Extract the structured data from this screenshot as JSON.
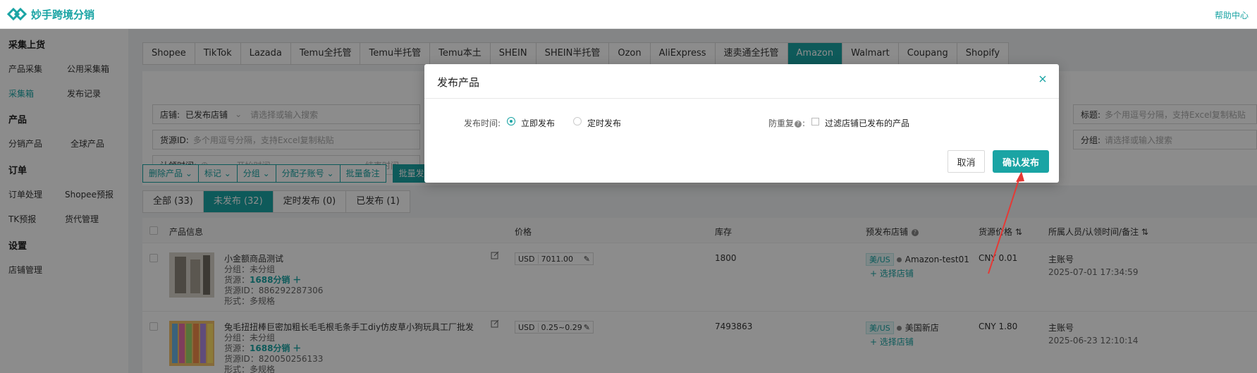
{
  "header": {
    "app_name": "妙手跨境分销",
    "help": "帮助中心"
  },
  "sidebar": {
    "sections": [
      {
        "title": "采集上货",
        "items": [
          "产品采集",
          "公用采集箱",
          "采集箱",
          "发布记录"
        ]
      },
      {
        "title": "产品",
        "items": [
          "分销产品",
          "全球产品"
        ]
      },
      {
        "title": "订单",
        "items": [
          "订单处理",
          "Shopee预报",
          "TK预报",
          "货代管理"
        ]
      },
      {
        "title": "设置",
        "items": [
          "店铺管理"
        ]
      }
    ],
    "active": "采集箱"
  },
  "platform_tabs": [
    "Shopee",
    "TikTok",
    "Lazada",
    "Temu全托管",
    "Temu半托管",
    "Temu本土",
    "SHEIN",
    "SHEIN半托管",
    "Ozon",
    "AliExpress",
    "速卖通全托管",
    "Amazon",
    "Walmart",
    "Coupang",
    "Shopify"
  ],
  "platform_active": "Amazon",
  "filters": {
    "shop_label": "店铺:",
    "shop_value": "已发布店铺",
    "shop_placeholder": "请选择或输入搜索",
    "source_id_label": "货源ID:",
    "source_id_placeholder": "多个用逗号分隔，支持Excel复制粘贴",
    "claim_time_label": "认领时间:",
    "start_time": "开始时间",
    "dash": "-",
    "end_time": "结束时间",
    "title_label": "标题:",
    "title_placeholder": "多个用逗号分隔，支持Excel复制粘贴",
    "group_label": "分组:",
    "group_placeholder": "请选择或输入搜索"
  },
  "actions": [
    "删除产品",
    "标记",
    "分组",
    "分配子账号",
    "批量备注",
    "批量发布"
  ],
  "status_tabs": [
    "全部 (33)",
    "未发布 (32)",
    "定时发布 (0)",
    "已发布 (1)"
  ],
  "status_active": "未发布 (32)",
  "table": {
    "headers": [
      "产品信息",
      "价格",
      "库存",
      "预发布店铺",
      "货源价格",
      "所属人员/认领时间/备注"
    ],
    "rows": [
      {
        "title": "小金额商品测试",
        "group": "分组：未分组",
        "source_prefix": "货源：",
        "source": "1688分销",
        "source_id": "货源ID：886292287306",
        "form": "形式：多规格",
        "currency": "USD",
        "price": "7011.00",
        "stock": "1800",
        "region": "美/US",
        "shop": "Amazon-test01",
        "select_shop": "+ 选择店铺",
        "source_price": "CNY 0.01",
        "owner": "主账号",
        "claim_time": "2025-07-01 17:34:59"
      },
      {
        "title": "兔毛扭扭棒巨密加粗长毛毛根毛条手工diy仿皮草小狗玩具工厂批发",
        "group": "分组：未分组",
        "source_prefix": "货源：",
        "source": "1688分销",
        "source_id": "货源ID：820050256133",
        "form": "形式：多规格",
        "currency": "USD",
        "price": "0.25~0.29",
        "stock": "7493863",
        "region": "美/US",
        "shop": "美国新店",
        "select_shop": "+ 选择店铺",
        "source_price": "CNY 1.80",
        "owner": "主账号",
        "claim_time": "2025-06-23 12:10:14"
      }
    ]
  },
  "modal": {
    "title": "发布产品",
    "publish_time_label": "发布时间:",
    "option_now": "立即发布",
    "option_scheduled": "定时发布",
    "dedupe_label": "防重复",
    "dedupe_suffix": ":",
    "dedupe_option": "过滤店铺已发布的产品",
    "cancel": "取消",
    "confirm": "确认发布"
  },
  "colors": {
    "accent": "#1aa4a4",
    "annotation_arrow": "#e53935"
  },
  "icons": {
    "close": "close-icon",
    "clock": "clock-icon",
    "edit": "edit-icon",
    "help": "help-circle-icon"
  }
}
